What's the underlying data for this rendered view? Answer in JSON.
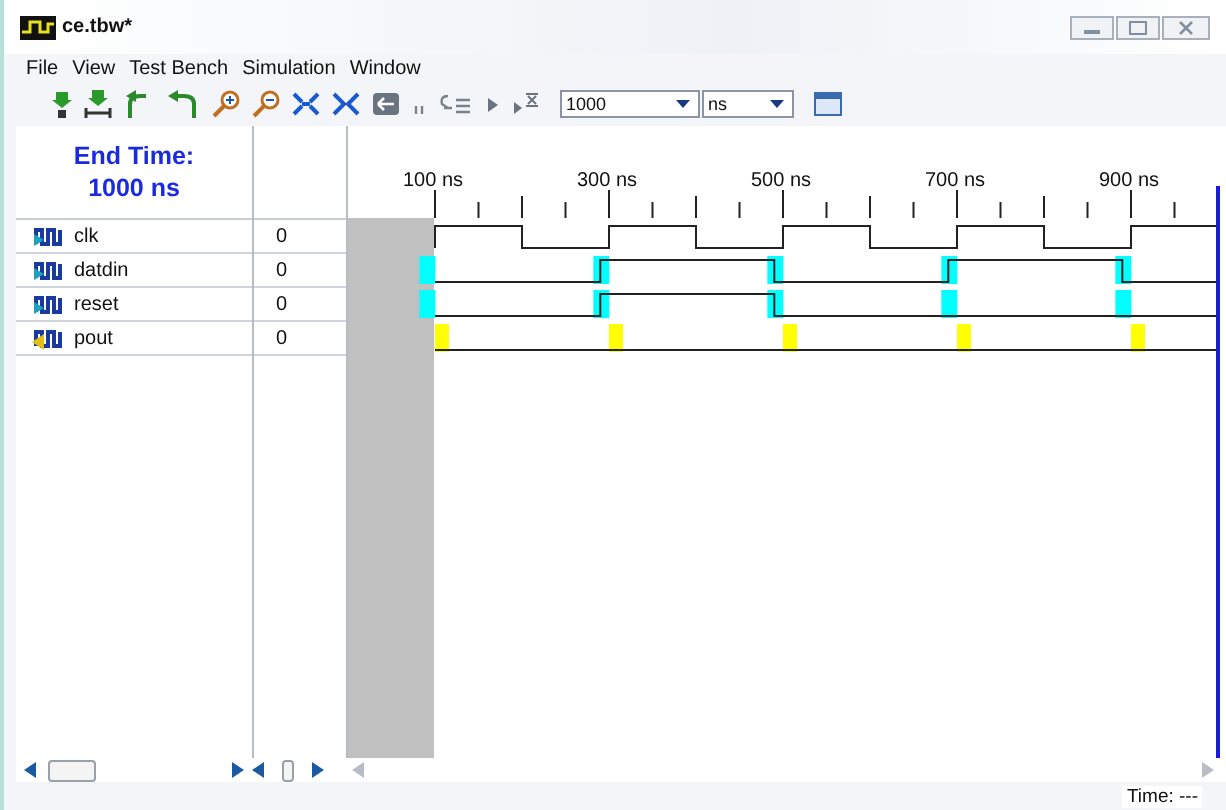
{
  "window": {
    "title": "ce.tbw*"
  },
  "menu": [
    "File",
    "View",
    "Test Bench",
    "Simulation",
    "Window"
  ],
  "toolbar": {
    "end_time": "1000",
    "unit": "ns"
  },
  "header": {
    "end_time_label": "End Time:",
    "end_time_value": "1000 ns"
  },
  "time_scale": [
    "100 ns",
    "300 ns",
    "500 ns",
    "700 ns",
    "900 ns"
  ],
  "signals": [
    {
      "name": "clk",
      "value": "0",
      "kind": "clock"
    },
    {
      "name": "datdin",
      "value": "0",
      "kind": "input"
    },
    {
      "name": "reset",
      "value": "0",
      "kind": "input"
    },
    {
      "name": "pout",
      "value": "0",
      "kind": "output"
    }
  ],
  "status_bar": {
    "time": "Time: ---"
  }
}
